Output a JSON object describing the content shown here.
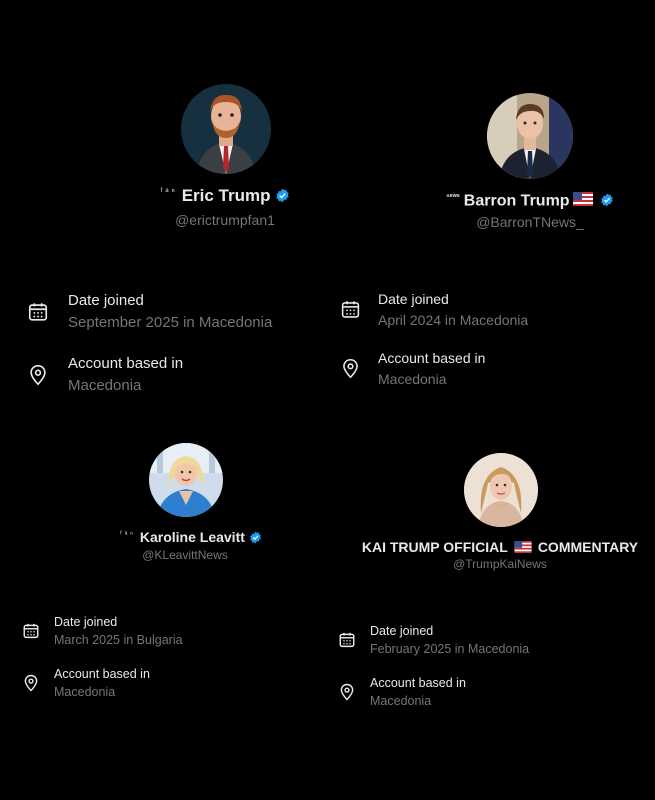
{
  "profiles": [
    {
      "prefix": "ᶠᵃⁿ",
      "name": "Eric Trump",
      "handle": "@erictrumpfan1",
      "date_joined_label": "Date joined",
      "date_joined_value": "September 2025 in Macedonia",
      "based_label": "Account based in",
      "based_value": "Macedonia"
    },
    {
      "prefix": "ⁿᵉʷˢ",
      "name": "Barron Trump",
      "handle": "@BarronTNews_",
      "date_joined_label": "Date joined",
      "date_joined_value": "April 2024 in Macedonia",
      "based_label": "Account based in",
      "based_value": "Macedonia"
    },
    {
      "prefix": "ᶠᵃⁿ",
      "name": "Karoline Leavitt",
      "handle": "@KLeavittNews",
      "date_joined_label": "Date joined",
      "date_joined_value": "March 2025 in Bulgaria",
      "based_label": "Account based in",
      "based_value": "Macedonia"
    },
    {
      "name_part1": "KAI TRUMP OFFICIAL",
      "name_part2": "COMMENTARY",
      "handle": "@TrumpKaiNews",
      "date_joined_label": "Date joined",
      "date_joined_value": "February 2025 in Macedonia",
      "based_label": "Account based in",
      "based_value": "Macedonia"
    }
  ],
  "colors": {
    "background": "#000000",
    "primary_text": "#e7e9ea",
    "secondary_text": "#71767b",
    "verified_blue": "#1d9bf0"
  }
}
